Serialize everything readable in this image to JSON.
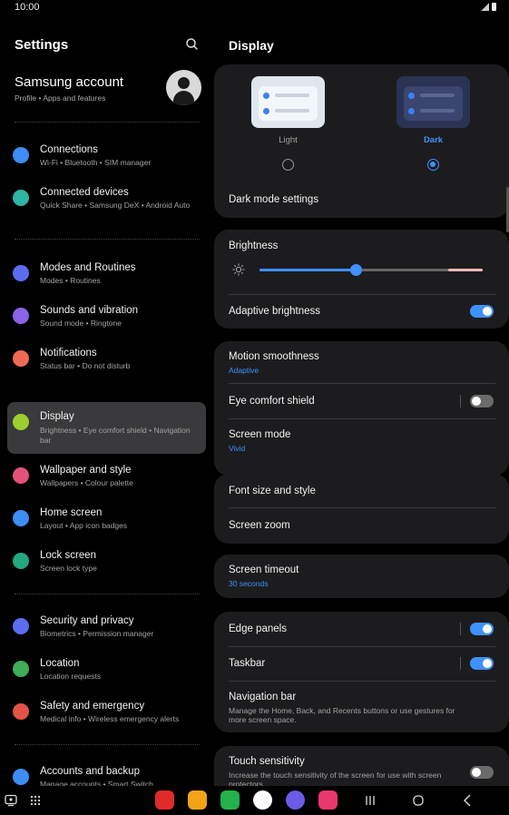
{
  "status": {
    "time": "10:00"
  },
  "left": {
    "title": "Settings",
    "account": {
      "name": "Samsung account",
      "sub": "Profile  •  Apps and features"
    },
    "items": [
      {
        "label": "Connections",
        "sub": "Wi-Fi  •  Bluetooth  •  SIM manager",
        "color": "#3e8df5",
        "icon": "wifi-icon"
      },
      {
        "label": "Connected devices",
        "sub": "Quick Share  •  Samsung DeX  •  Android Auto",
        "color": "#2fb3a3",
        "icon": "devices-icon"
      },
      {
        "label": "Modes and Routines",
        "sub": "Modes  •  Routines",
        "color": "#5b6cf0",
        "icon": "check-circle-icon"
      },
      {
        "label": "Sounds and vibration",
        "sub": "Sound mode  •  Ringtone",
        "color": "#8a63e8",
        "icon": "speaker-icon"
      },
      {
        "label": "Notifications",
        "sub": "Status bar  •  Do not disturb",
        "color": "#ee6a55",
        "icon": "bell-icon"
      },
      {
        "label": "Display",
        "sub": "Brightness  •  Eye comfort shield  •  Navigation bar",
        "color": "#9ccf2f",
        "icon": "sun-icon"
      },
      {
        "label": "Wallpaper and style",
        "sub": "Wallpapers  •  Colour palette",
        "color": "#e4517a",
        "icon": "image-icon"
      },
      {
        "label": "Home screen",
        "sub": "Layout  •  App icon badges",
        "color": "#3e8df5",
        "icon": "home-icon"
      },
      {
        "label": "Lock screen",
        "sub": "Screen lock type",
        "color": "#24a87f",
        "icon": "lock-icon"
      },
      {
        "label": "Security and privacy",
        "sub": "Biometrics  •  Permission manager",
        "color": "#5b6cf0",
        "icon": "shield-icon"
      },
      {
        "label": "Location",
        "sub": "Location requests",
        "color": "#3fae57",
        "icon": "location-pin-icon"
      },
      {
        "label": "Safety and emergency",
        "sub": "Medical info  •  Wireless emergency alerts",
        "color": "#e35349",
        "icon": "emergency-icon"
      },
      {
        "label": "Accounts and backup",
        "sub": "Manage accounts  •  Smart Switch",
        "color": "#3e8df5",
        "icon": "sync-icon"
      }
    ]
  },
  "right": {
    "title": "Display",
    "theme": {
      "light": "Light",
      "dark": "Dark",
      "selected": "dark"
    },
    "dark_mode_settings": "Dark mode settings",
    "brightness": {
      "label": "Brightness",
      "level": 0.43
    },
    "adaptive_brightness": {
      "label": "Adaptive brightness",
      "on": true
    },
    "motion_smoothness": {
      "label": "Motion smoothness",
      "value": "Adaptive"
    },
    "eye_comfort": {
      "label": "Eye comfort shield",
      "on": false
    },
    "screen_mode": {
      "label": "Screen mode",
      "value": "Vivid"
    },
    "font_size": "Font size and style",
    "screen_zoom": "Screen zoom",
    "screen_timeout": {
      "label": "Screen timeout",
      "value": "30 seconds"
    },
    "edge_panels": {
      "label": "Edge panels",
      "on": true
    },
    "taskbar": {
      "label": "Taskbar",
      "on": true
    },
    "navigation_bar": {
      "label": "Navigation bar",
      "desc": "Manage the Home, Back, and Recents buttons or use gestures for more screen space."
    },
    "touch_sensitivity": {
      "label": "Touch sensitivity",
      "desc": "Increase the touch sensitivity of the screen for use with screen protectors.",
      "on": false
    }
  },
  "navbar": {
    "apps": [
      {
        "name": "flipboard-app-icon",
        "color": "#e02a2a"
      },
      {
        "name": "my-files-app-icon",
        "color": "#f2a418"
      },
      {
        "name": "phone-app-icon",
        "color": "#22b14c"
      },
      {
        "name": "messages-app-icon",
        "color": "#ffffff"
      },
      {
        "name": "internet-app-icon",
        "color": "#6a5ce6"
      },
      {
        "name": "camera-app-icon",
        "color": "#e8376b"
      }
    ]
  }
}
